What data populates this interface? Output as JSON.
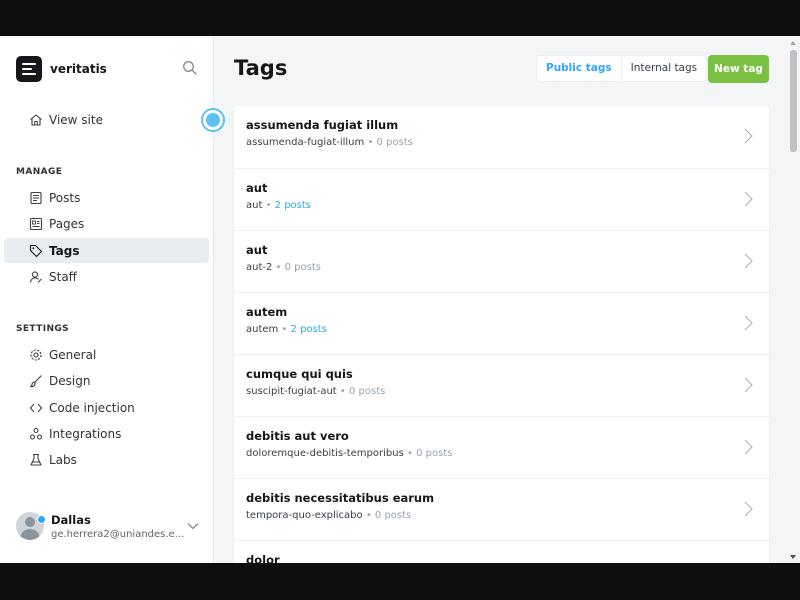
{
  "brand": {
    "name": "veritatis"
  },
  "sidebar": {
    "view_site": "View site",
    "manage_label": "MANAGE",
    "manage_items": [
      {
        "label": "Posts",
        "icon": "posts-icon"
      },
      {
        "label": "Pages",
        "icon": "pages-icon"
      },
      {
        "label": "Tags",
        "icon": "tag-icon",
        "active": true
      },
      {
        "label": "Staff",
        "icon": "staff-icon"
      }
    ],
    "settings_label": "SETTINGS",
    "settings_items": [
      {
        "label": "General",
        "icon": "gear-icon"
      },
      {
        "label": "Design",
        "icon": "brush-icon"
      },
      {
        "label": "Code injection",
        "icon": "code-icon"
      },
      {
        "label": "Integrations",
        "icon": "integrations-icon"
      },
      {
        "label": "Labs",
        "icon": "flask-icon"
      }
    ]
  },
  "user": {
    "name": "Dallas",
    "email": "ge.herrera2@uniandes.e..."
  },
  "header": {
    "title": "Tags",
    "public_tags": "Public tags",
    "internal_tags": "Internal tags",
    "new_tag": "New tag"
  },
  "tags": [
    {
      "name": "assumenda fugiat illum",
      "slug": "assumenda-fugiat-illum",
      "sep": "•",
      "count": "0 posts"
    },
    {
      "name": "aut",
      "slug": "aut",
      "sep": "•",
      "count": "2 posts"
    },
    {
      "name": "aut",
      "slug": "aut-2",
      "sep": "•",
      "count": "0 posts"
    },
    {
      "name": "autem",
      "slug": "autem",
      "sep": "•",
      "count": "2 posts"
    },
    {
      "name": "cumque qui quis",
      "slug": "suscipit-fugiat-aut",
      "sep": "•",
      "count": "0 posts"
    },
    {
      "name": "debitis aut vero",
      "slug": "doloremque-debitis-temporibus",
      "sep": "•",
      "count": "0 posts"
    },
    {
      "name": "debitis necessitatibus earum",
      "slug": "tempora-quo-explicabo",
      "sep": "•",
      "count": "0 posts"
    },
    {
      "name": "dolor",
      "slug": "",
      "sep": "",
      "count": ""
    }
  ],
  "colors": {
    "accent": "#30a9f3",
    "primary_button": "#7ac142",
    "active_nav_bg": "#e9ecf0"
  }
}
